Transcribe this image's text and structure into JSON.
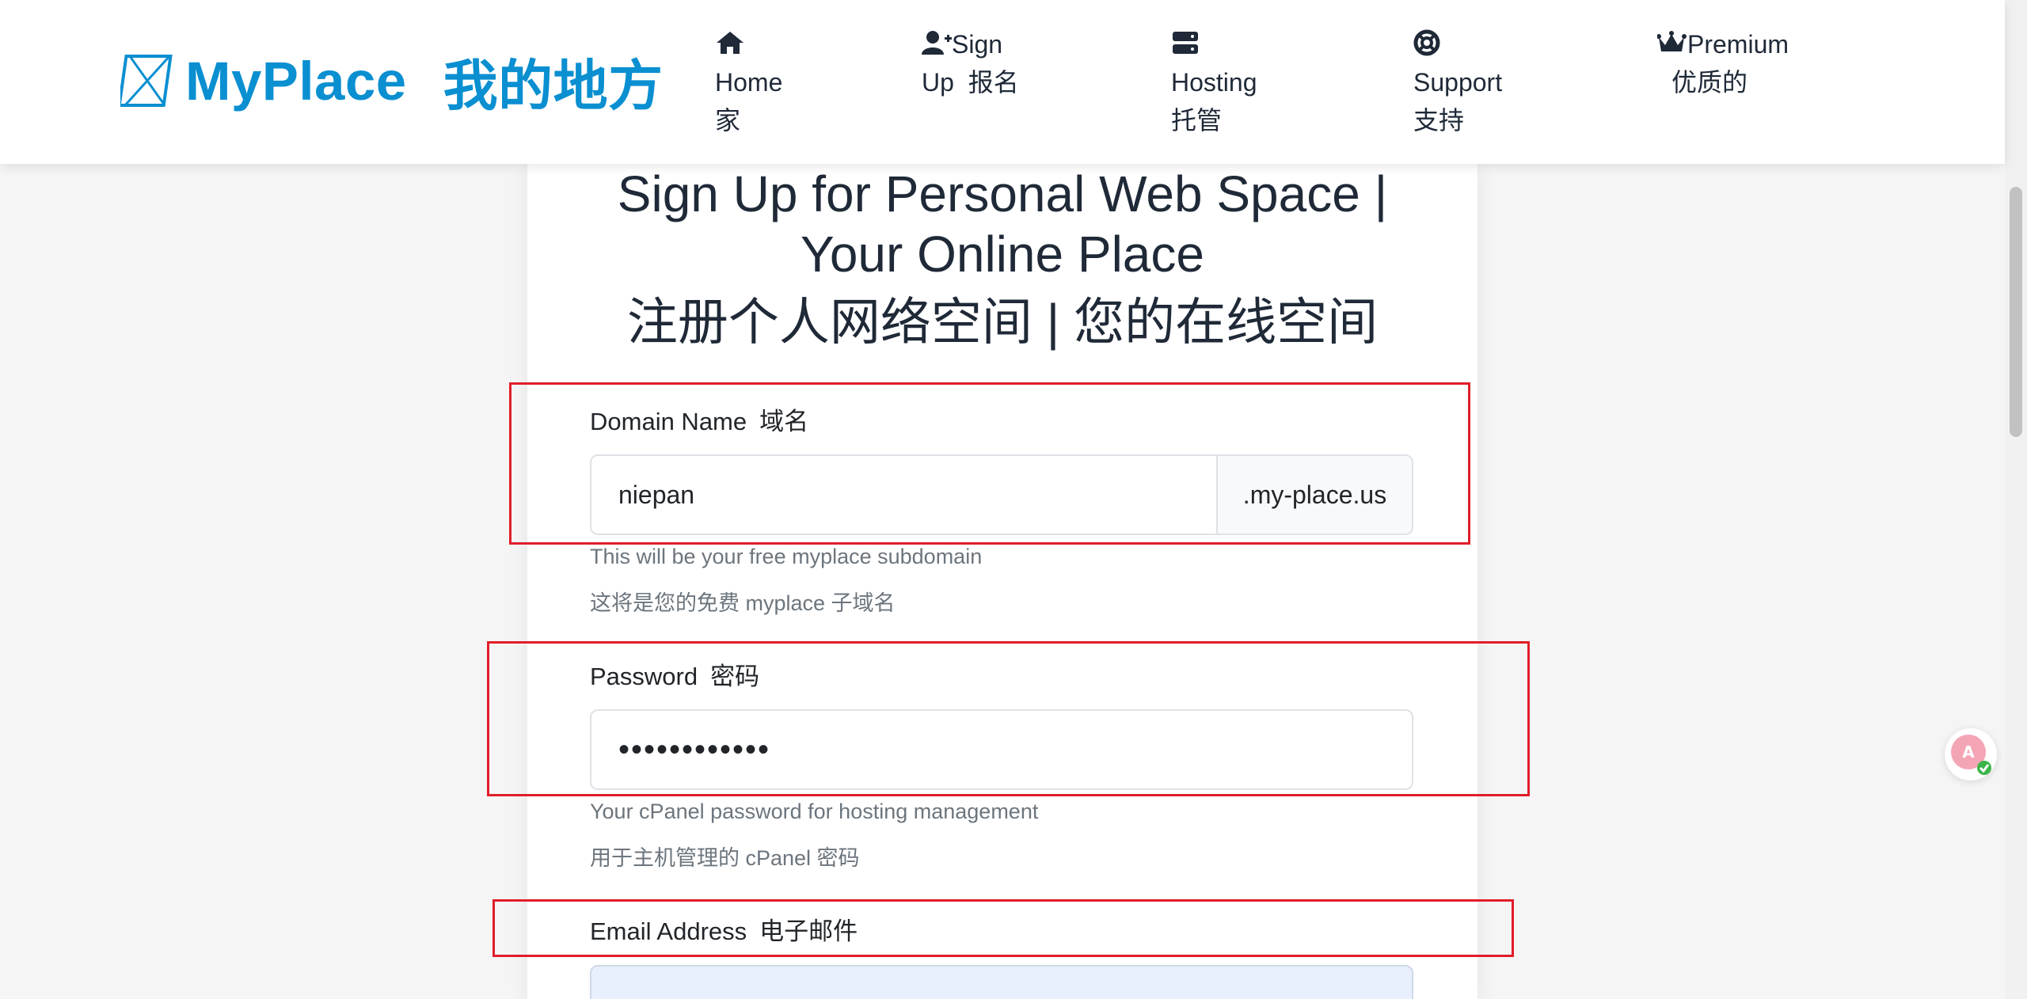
{
  "brand": {
    "name_en": "MyPlace",
    "name_cn": "我的地方"
  },
  "nav": {
    "items": [
      {
        "icon": "home-icon",
        "label_en": "Home",
        "label_cn": "家"
      },
      {
        "icon": "user-plus-icon",
        "label_en_line1": "Sign",
        "label_en_line2": "Up",
        "label_cn": "报名"
      },
      {
        "icon": "server-icon",
        "label_en": "Hosting",
        "label_cn": "托管"
      },
      {
        "icon": "life-ring-icon",
        "label_en": "Support",
        "label_cn": "支持"
      },
      {
        "icon": "crown-icon",
        "label_en": "Premium",
        "label_cn": "优质的"
      }
    ]
  },
  "page": {
    "title_en_line1": "Sign Up for Personal Web Space |",
    "title_en_line2": "Your Online Place",
    "title_cn": "注册个人网络空间 | 您的在线空间"
  },
  "form": {
    "domain": {
      "label_en": "Domain Name",
      "label_cn": "域名",
      "value": "niepan",
      "suffix": ".my-place.us",
      "help_en": "This will be your free myplace subdomain",
      "help_cn": "这将是您的免费 myplace 子域名"
    },
    "password": {
      "label_en": "Password",
      "label_cn": "密码",
      "value_masked": "••••••••••••",
      "help_en": "Your cPanel password for hosting management",
      "help_cn": "用于主机管理的 cPanel 密码"
    },
    "email": {
      "label_en": "Email Address",
      "label_cn": "电子邮件"
    }
  },
  "colors": {
    "brand": "#0a8fd1",
    "highlight_box": "#e11d2a",
    "text": "#1f2937",
    "muted": "#6c757d"
  }
}
